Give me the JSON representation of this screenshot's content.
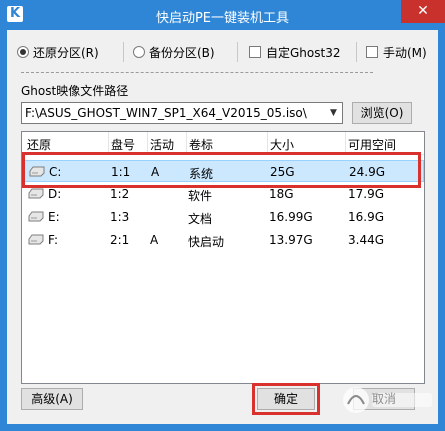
{
  "window": {
    "title": "快启动PE一键装机工具",
    "app_icon": "K",
    "close_label": "✕"
  },
  "options": {
    "restore": "还原分区(R)",
    "backup": "备份分区(B)",
    "custom_ghost": "自定Ghost32",
    "manual": "手动(M)"
  },
  "path": {
    "label": "Ghost映像文件路径",
    "value": "F:\\ASUS_GHOST_WIN7_SP1_X64_V2015_05.iso\\",
    "browse_label": "浏览(O)"
  },
  "table": {
    "headers": [
      "还原",
      "盘号",
      "活动",
      "卷标",
      "大小",
      "可用空间"
    ],
    "rows": [
      {
        "drive": "C:",
        "num": "1:1",
        "active": "A",
        "label": "系统",
        "size": "25G",
        "free": "24.9G"
      },
      {
        "drive": "D:",
        "num": "1:2",
        "active": "",
        "label": "软件",
        "size": "18G",
        "free": "17.9G"
      },
      {
        "drive": "E:",
        "num": "1:3",
        "active": "",
        "label": "文档",
        "size": "16.99G",
        "free": "16.9G"
      },
      {
        "drive": "F:",
        "num": "2:1",
        "active": "A",
        "label": "快启动",
        "size": "13.97G",
        "free": "3.44G"
      }
    ]
  },
  "footer": {
    "advanced_label": "高级(A)",
    "ok_label": "确定",
    "cancel_label": "取消"
  },
  "colors": {
    "titlebar": "#2f86d6",
    "highlight": "#d8312e",
    "selection": "#cce8ff"
  }
}
